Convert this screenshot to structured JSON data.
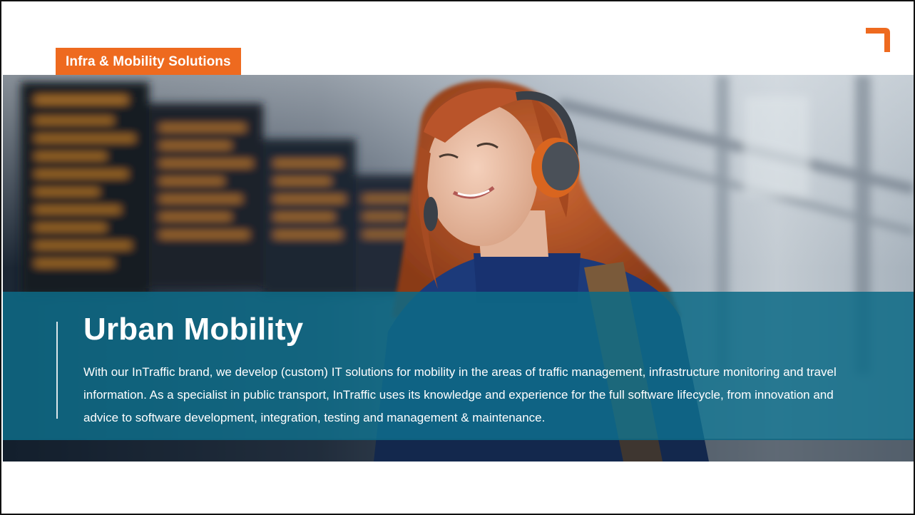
{
  "brand": {
    "accent_color": "#ee6a1f",
    "band_color": "#0d6a86",
    "logo_icon": "corner-bracket-logo-icon"
  },
  "header": {
    "category_tag": "Infra & Mobility Solutions"
  },
  "hero": {
    "image_subject": "woman-with-headphones-at-train-station-photo"
  },
  "content": {
    "title": "Urban Mobility",
    "body": "With our InTraffic brand, we develop (custom) IT solutions for mobility in the areas of traffic management, infrastructure monitoring and travel information. As a specialist in public transport, InTraffic uses its knowledge and experience for the full software lifecycle, from innovation and advice to software development, integration, testing and management & maintenance."
  }
}
